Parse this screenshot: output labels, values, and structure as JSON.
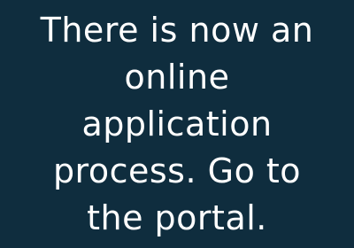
{
  "colors": {
    "background": "#0f2d3e",
    "text": "#ffffff"
  },
  "message": {
    "lines": [
      "There is now an",
      "online",
      "application",
      "process. Go to",
      "the portal."
    ]
  }
}
